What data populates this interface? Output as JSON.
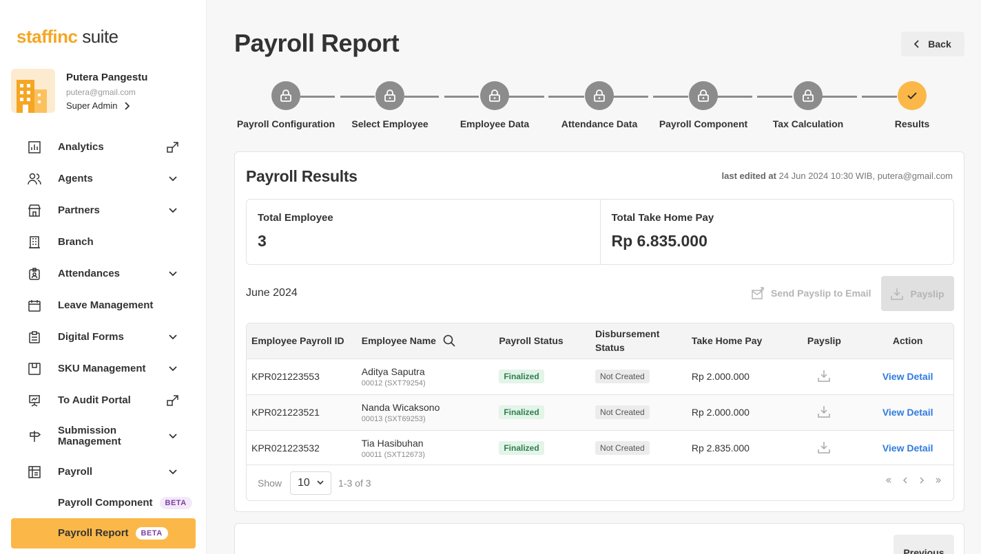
{
  "app": {
    "logo_brand": "staffinc",
    "logo_suite": "suite",
    "brand_color": "#f5a623"
  },
  "user": {
    "name": "Putera Pangestu",
    "email": "putera@gmail.com",
    "role": "Super Admin"
  },
  "sidebar": {
    "items": [
      {
        "label": "Analytics",
        "icon": "bar-chart-icon",
        "trail": "external-link-icon"
      },
      {
        "label": "Agents",
        "icon": "users-icon",
        "trail": "chevron-down-icon"
      },
      {
        "label": "Partners",
        "icon": "store-icon",
        "trail": "chevron-down-icon"
      },
      {
        "label": "Branch",
        "icon": "building-icon",
        "trail": ""
      },
      {
        "label": "Attendances",
        "icon": "badge-icon",
        "trail": "chevron-down-icon"
      },
      {
        "label": "Leave Management",
        "icon": "calendar-icon",
        "trail": ""
      },
      {
        "label": "Digital Forms",
        "icon": "clipboard-icon",
        "trail": "chevron-down-icon"
      },
      {
        "label": "SKU Management",
        "icon": "box-icon",
        "trail": "chevron-down-icon"
      },
      {
        "label": "To Audit Portal",
        "icon": "presentation-icon",
        "trail": "external-link-icon"
      },
      {
        "label": "Submission Management",
        "icon": "signpost-icon",
        "trail": "chevron-down-icon"
      },
      {
        "label": "Payroll",
        "icon": "payroll-icon",
        "trail": "chevron-down-icon"
      }
    ],
    "sub_items": [
      {
        "label": "Payroll Component",
        "badge": "BETA",
        "active": false
      },
      {
        "label": "Payroll Report",
        "badge": "BETA",
        "active": true
      }
    ]
  },
  "header": {
    "title": "Payroll Report",
    "back_label": "Back"
  },
  "stepper": {
    "steps": [
      {
        "label": "Payroll Configuration",
        "state": "locked"
      },
      {
        "label": "Select Employee",
        "state": "locked"
      },
      {
        "label": "Employee Data",
        "state": "locked"
      },
      {
        "label": "Attendance Data",
        "state": "locked"
      },
      {
        "label": "Payroll Component",
        "state": "locked"
      },
      {
        "label": "Tax Calculation",
        "state": "locked"
      },
      {
        "label": "Results",
        "state": "done"
      }
    ]
  },
  "results": {
    "title": "Payroll Results",
    "last_edited_label": "last edited at",
    "last_edited_value": "24 Jun 2024 10:30 WIB, putera@gmail.com",
    "total_employee_label": "Total Employee",
    "total_employee_value": "3",
    "total_thp_label": "Total Take Home Pay",
    "total_thp_value": "Rp 6.835.000",
    "period": "June 2024",
    "send_email_label": "Send Payslip to Email",
    "payslip_label": "Payslip"
  },
  "table": {
    "headers": {
      "id": "Employee Payroll ID",
      "name": "Employee Name",
      "payroll_status": "Payroll Status",
      "disb_status_1": "Disbursement",
      "disb_status_2": "Status",
      "thp": "Take Home Pay",
      "payslip": "Payslip",
      "action": "Action"
    },
    "rows": [
      {
        "id": "KPR021223553",
        "name": "Aditya Saputra",
        "sub": "00012 (SXT79254)",
        "payroll_status": "Finalized",
        "disb_status": "Not Created",
        "thp": "Rp 2.000.000",
        "action": "View Detail"
      },
      {
        "id": "KPR021223521",
        "name": "Nanda Wicaksono",
        "sub": "00013 (SXT69253)",
        "payroll_status": "Finalized",
        "disb_status": "Not Created",
        "thp": "Rp 2.000.000",
        "action": "View Detail"
      },
      {
        "id": "KPR021223532",
        "name": "Tia Hasibuhan",
        "sub": "00011 (SXT12673)",
        "payroll_status": "Finalized",
        "disb_status": "Not Created",
        "thp": "Rp 2.835.000",
        "action": "View Detail"
      }
    ]
  },
  "pagination": {
    "show_label": "Show",
    "page_size": "10",
    "range": "1-3 of 3"
  },
  "footer": {
    "previous_label": "Previous"
  }
}
